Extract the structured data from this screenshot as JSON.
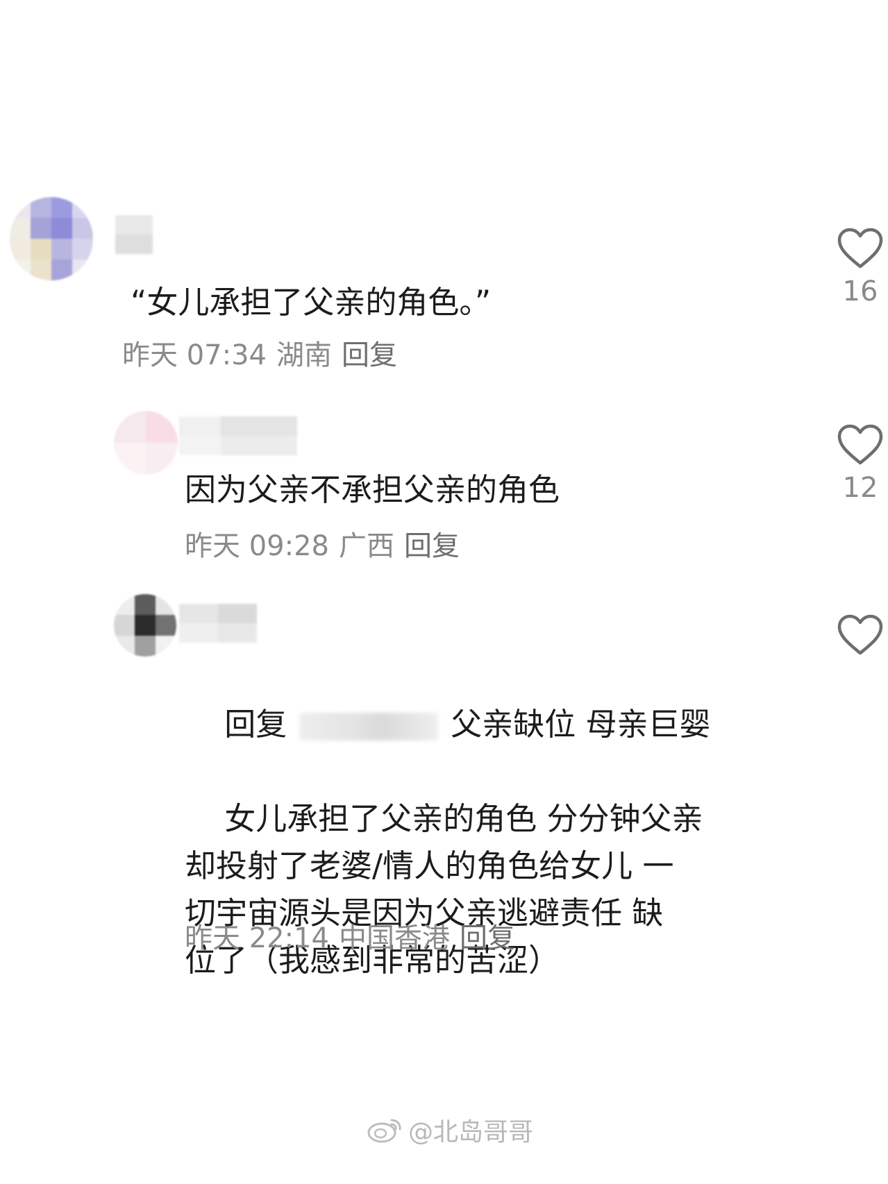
{
  "comments": [
    {
      "text": "“女儿承担了父亲的角色。”",
      "time": "昨天 07:34",
      "location": "湖南",
      "reply_label": "回复",
      "likes": "16"
    },
    {
      "text": "因为父亲不承担父亲的角色",
      "time": "昨天 09:28",
      "location": "广西",
      "reply_label": "回复",
      "likes": "12"
    },
    {
      "reply_prefix": "回复",
      "text_line1_after": "父亲缺位 母亲巨婴",
      "text_rest": "女儿承担了父亲的角色 分分钟父亲\n却投射了老婆/情人的角色给女儿 一\n切宇宙源头是因为父亲逃避责任 缺\n位了（我感到非常的苦涩）",
      "time": "昨天 22:14",
      "location": "中国香港",
      "reply_label": "回复",
      "likes": ""
    }
  ],
  "icons": {
    "like": "heart-outline-icon",
    "watermark": "weibo-logo-icon"
  },
  "watermark": {
    "text": "@北岛哥哥"
  },
  "colors": {
    "text": "#1c1c1c",
    "meta": "#8a8a8a",
    "icon": "#6e6e6e",
    "background": "#ffffff"
  }
}
